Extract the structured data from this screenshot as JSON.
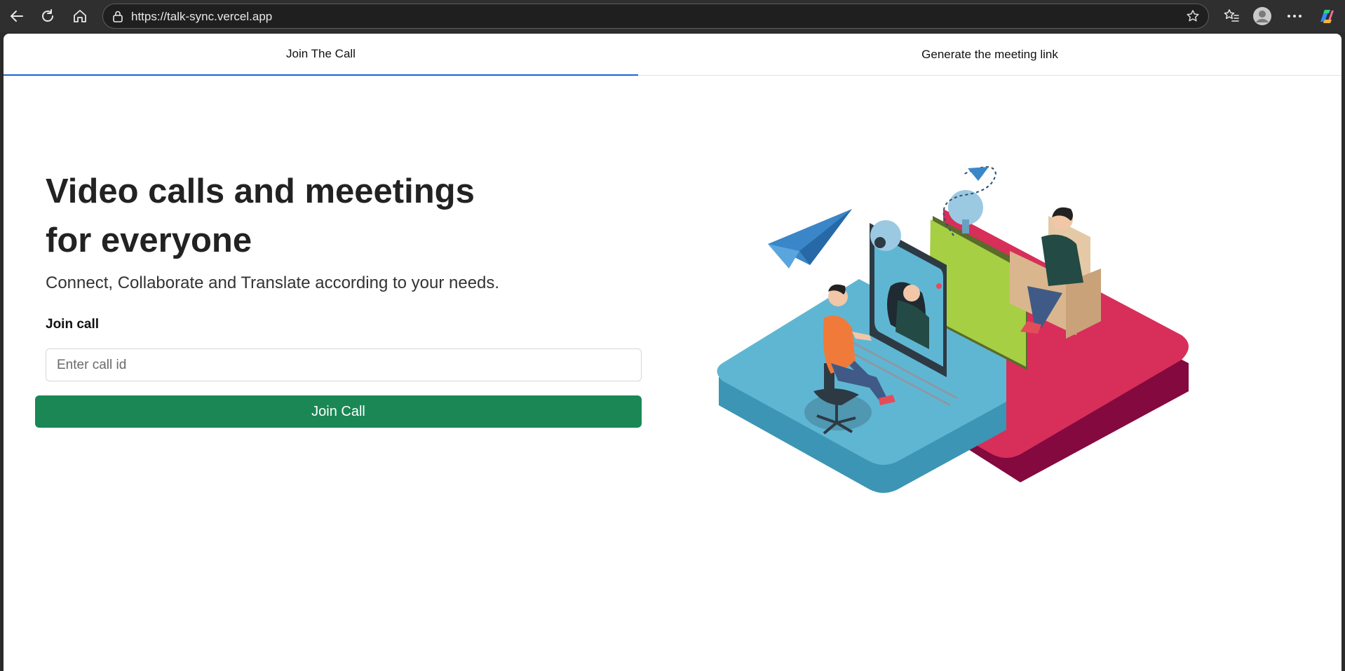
{
  "browser": {
    "url": "https://talk-sync.vercel.app",
    "icons": [
      "back-icon",
      "reload-icon",
      "home-icon",
      "lock-icon",
      "star-icon",
      "favorites-icon",
      "profile-icon",
      "more-icon",
      "copilot-icon"
    ]
  },
  "tabs": [
    {
      "label": "Join The Call",
      "active": true
    },
    {
      "label": "Generate the meeting link",
      "active": false
    }
  ],
  "hero": {
    "title_line1": "Video calls and meeetings",
    "title_line2": "for everyone",
    "subtitle": "Connect, Collaborate and Translate according to your needs."
  },
  "join": {
    "label": "Join call",
    "placeholder": "Enter call id",
    "value": "",
    "button_label": "Join Call"
  },
  "colors": {
    "accent_tab": "#1765d8",
    "button": "#1a8754",
    "illustration_blue": "#5fb6d3",
    "illustration_red": "#d72f5a",
    "illustration_green": "#a6cf44"
  }
}
